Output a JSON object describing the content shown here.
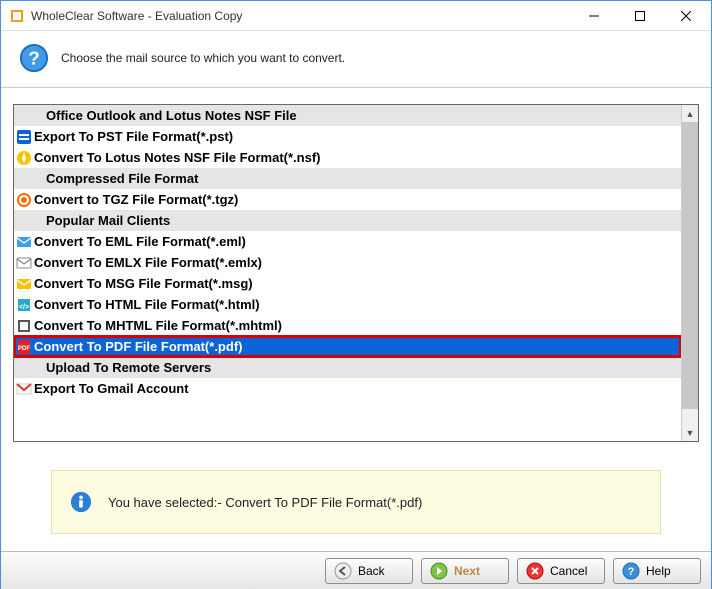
{
  "window": {
    "title": "WholeClear Software - Evaluation Copy"
  },
  "header": {
    "prompt": "Choose the mail source to which you want to convert."
  },
  "list": {
    "items": [
      {
        "type": "header",
        "label": "Office Outlook and Lotus Notes NSF File"
      },
      {
        "type": "item",
        "icon": "pst",
        "label": "Export To PST File Format(*.pst)"
      },
      {
        "type": "item",
        "icon": "nsf",
        "label": "Convert To Lotus Notes NSF File Format(*.nsf)"
      },
      {
        "type": "header",
        "label": "Compressed File Format"
      },
      {
        "type": "item",
        "icon": "tgz",
        "label": "Convert to TGZ File Format(*.tgz)"
      },
      {
        "type": "header",
        "label": "Popular Mail Clients"
      },
      {
        "type": "item",
        "icon": "eml",
        "label": "Convert To EML File Format(*.eml)"
      },
      {
        "type": "item",
        "icon": "emlx",
        "label": "Convert To EMLX File Format(*.emlx)"
      },
      {
        "type": "item",
        "icon": "msg",
        "label": "Convert To MSG File Format(*.msg)"
      },
      {
        "type": "item",
        "icon": "html",
        "label": "Convert To HTML File Format(*.html)"
      },
      {
        "type": "item",
        "icon": "mhtml",
        "label": "Convert To MHTML File Format(*.mhtml)"
      },
      {
        "type": "item",
        "icon": "pdf",
        "label": "Convert To PDF File Format(*.pdf)",
        "selected": true
      },
      {
        "type": "header",
        "label": "Upload To Remote Servers"
      },
      {
        "type": "item",
        "icon": "gmail",
        "label": "Export To Gmail Account"
      }
    ]
  },
  "status": {
    "text": "You have selected:- Convert To PDF File Format(*.pdf)"
  },
  "buttons": {
    "back": "Back",
    "next": "Next",
    "cancel": "Cancel",
    "help": "Help"
  }
}
